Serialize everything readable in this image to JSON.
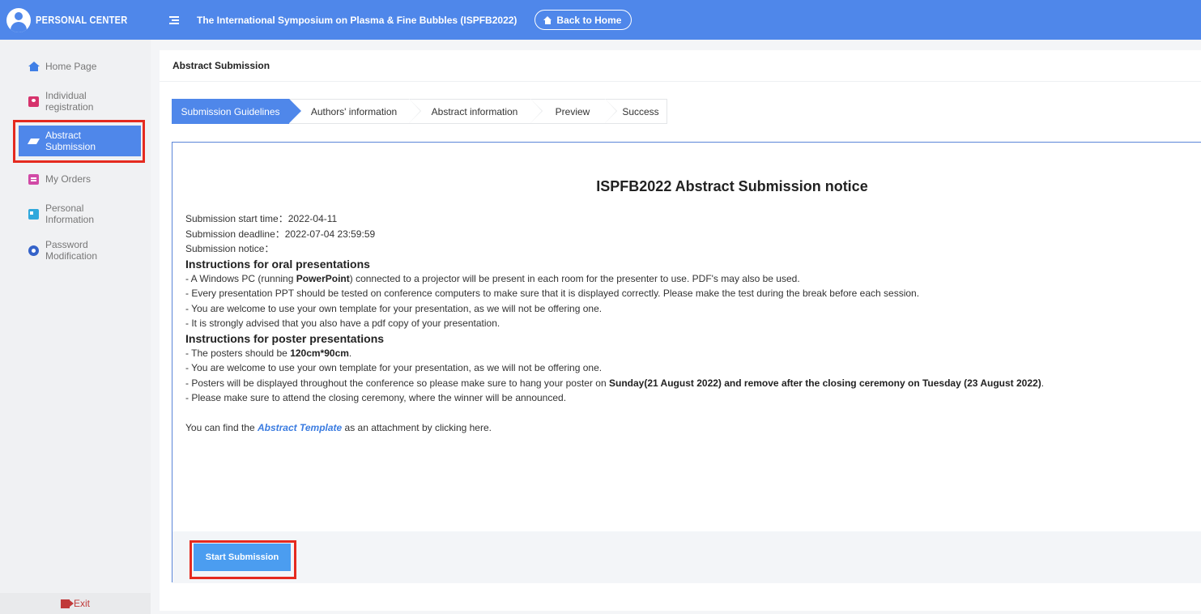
{
  "sidebar": {
    "brand": "PERSONAL CENTER",
    "items": [
      {
        "label": "Home Page",
        "icon": "home-icon"
      },
      {
        "label": "Individual\nregistration",
        "icon": "id-card-icon"
      },
      {
        "label": "Abstract\nSubmission",
        "icon": "edit-icon",
        "active": true
      },
      {
        "label": "My Orders",
        "icon": "clipboard-icon"
      },
      {
        "label": "Personal\nInformation",
        "icon": "info-card-icon"
      },
      {
        "label": "Password\nModification",
        "icon": "key-icon"
      }
    ],
    "exit_label": "Exit"
  },
  "topbar": {
    "title": "The International Symposium on Plasma & Fine Bubbles (ISPFB2022)",
    "back_label": "Back to Home"
  },
  "main": {
    "page_title": "Abstract Submission",
    "steps": [
      "Submission Guidelines",
      "Authors' information",
      "Abstract information",
      "Preview",
      "Success"
    ],
    "notice_title": "ISPFB2022 Abstract Submission notice",
    "start_time": "Submission start time：2022-04-11",
    "deadline": "Submission deadline：2022-07-04 23:59:59",
    "notice_label": "Submission notice：",
    "oral_heading": "Instructions for oral presentations",
    "oral_1_pre": "- A Windows PC (running ",
    "oral_1_bold": "PowerPoint",
    "oral_1_post": ") connected to a projector will be present in each room for the presenter to use. PDF's may also be used.",
    "oral_2": "- Every presentation PPT should be tested on conference computers to make sure that it is displayed correctly. Please make the test during the break before each session.",
    "oral_3": "- You are welcome to use your own template for your presentation, as we will not be offering one.",
    "oral_4": "- It is strongly advised that you also have a pdf copy of your presentation.",
    "poster_heading": "Instructions for poster presentations",
    "poster_1_pre": "- The posters should be ",
    "poster_1_bold": "120cm*90cm",
    "poster_1_post": ".",
    "poster_2": "- You are welcome to use your own template for your presentation, as we will not be offering one.",
    "poster_3_pre": "- Posters will be displayed throughout the conference so please make sure to hang your poster on ",
    "poster_3_bold": "Sunday(21 August 2022) and remove after the closing ceremony on Tuesday (23 August 2022)",
    "poster_3_post": ".",
    "poster_4": "- Please make sure to attend the closing ceremony, where the winner will be announced.",
    "template_pre": "You can find the ",
    "template_link": "Abstract Template",
    "template_post": " as an attachment by clicking here.",
    "start_button": "Start Submission"
  },
  "colors": {
    "primary": "#4f87ea",
    "highlight": "#e52a1f",
    "button": "#4b9df0"
  }
}
